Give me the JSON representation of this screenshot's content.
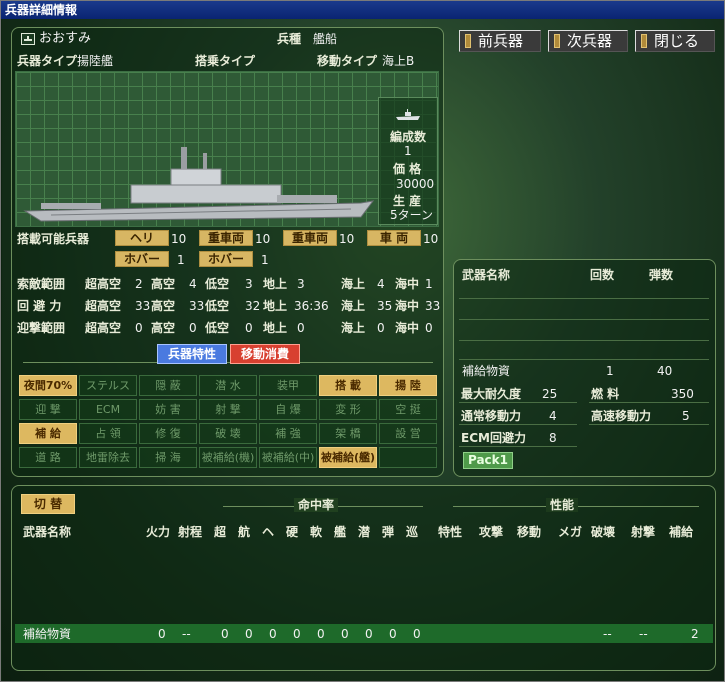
{
  "window": {
    "title": "兵器詳細情報"
  },
  "nav": {
    "prev": "前兵器",
    "next": "次兵器",
    "close": "閉じる"
  },
  "unit": {
    "name": "おおすみ",
    "type_label": "兵種",
    "type_value": "艦船",
    "weapon_type_label": "兵器タイプ",
    "weapon_type_value": "揚陸艦",
    "board_type_label": "搭乗タイプ",
    "board_type_value": "",
    "move_type_label": "移動タイプ",
    "move_type_value": "海上B",
    "formation_label": "編成数",
    "formation_value": "1",
    "price_label": "価 格",
    "price_value": "30000",
    "production_label": "生 産",
    "production_value": "5ターン"
  },
  "carry": {
    "label": "搭載可能兵器",
    "items": [
      {
        "name": "ヘリ",
        "value": "10"
      },
      {
        "name": "重車両",
        "value": "10"
      },
      {
        "name": "重車両",
        "value": "10"
      },
      {
        "name": "車 両",
        "value": "10"
      },
      {
        "name": "ホバー",
        "value": "1"
      },
      {
        "name": "ホバー",
        "value": "1"
      }
    ]
  },
  "ranges": {
    "cols": [
      "超高空",
      "高空",
      "低空",
      "地上",
      "海上",
      "海中"
    ],
    "rows": [
      {
        "label": "索敵範囲",
        "values": [
          "2",
          "4",
          "3",
          "3",
          "4",
          "1"
        ]
      },
      {
        "label": "回 避 力",
        "values": [
          "33",
          "33",
          "32",
          "36:36",
          "35",
          "33"
        ]
      },
      {
        "label": "迎撃範囲",
        "values": [
          "0",
          "0",
          "0",
          "0",
          "0",
          "0"
        ]
      }
    ]
  },
  "tabs": {
    "traits": "兵器特性",
    "consumption": "移動消費"
  },
  "traits": [
    [
      "夜間70%",
      "ステルス",
      "隠 蔽",
      "潜 水",
      "装甲",
      "搭 載",
      "揚 陸"
    ],
    [
      "迎 撃",
      "ECM",
      "妨 害",
      "射 撃",
      "自 爆",
      "変 形",
      "空 挺"
    ],
    [
      "補 給",
      "占 領",
      "修 復",
      "破 壊",
      "補 強",
      "架 橋",
      "設 営"
    ],
    [
      "道 路",
      "地雷除去",
      "掃 海",
      "被補給(機)",
      "被補給(中)",
      "被補給(艦)",
      ""
    ]
  ],
  "weapons_panel": {
    "name_header": "武器名称",
    "count_header": "回数",
    "ammo_header": "弾数",
    "items": [
      {
        "name": "補給物資",
        "count": "1",
        "ammo": "40"
      }
    ],
    "stats": [
      {
        "label": "最大耐久度",
        "value": "25"
      },
      {
        "label": "燃 料",
        "value": "350"
      },
      {
        "label": "通常移動力",
        "value": "4"
      },
      {
        "label": "高速移動力",
        "value": "5"
      },
      {
        "label": "ECM回避力",
        "value": "8"
      }
    ],
    "pack": "Pack1"
  },
  "bottom": {
    "switch": "切 替",
    "group_hit": "命中率",
    "group_perf": "性能",
    "headers": [
      "武器名称",
      "火力",
      "射程",
      "超",
      "航",
      "ヘ",
      "硬",
      "軟",
      "艦",
      "潜",
      "弾",
      "巡",
      "特性",
      "攻撃",
      "移動",
      "メガ",
      "破壊",
      "射撃",
      "補給"
    ],
    "row": {
      "name": "補給物資",
      "power": "0",
      "range": "--",
      "hits": [
        "0",
        "0",
        "0",
        "0",
        "0",
        "0",
        "0",
        "0",
        "0"
      ],
      "destroy": "--",
      "shoot": "--",
      "supply": "2"
    }
  },
  "colors": {
    "accent": "#ddb860",
    "panel_border": "#6d8f5d",
    "highlight_row": "#1e6a2a",
    "red_tab": "#d84030",
    "blue_tab": "#4a7ae0"
  }
}
